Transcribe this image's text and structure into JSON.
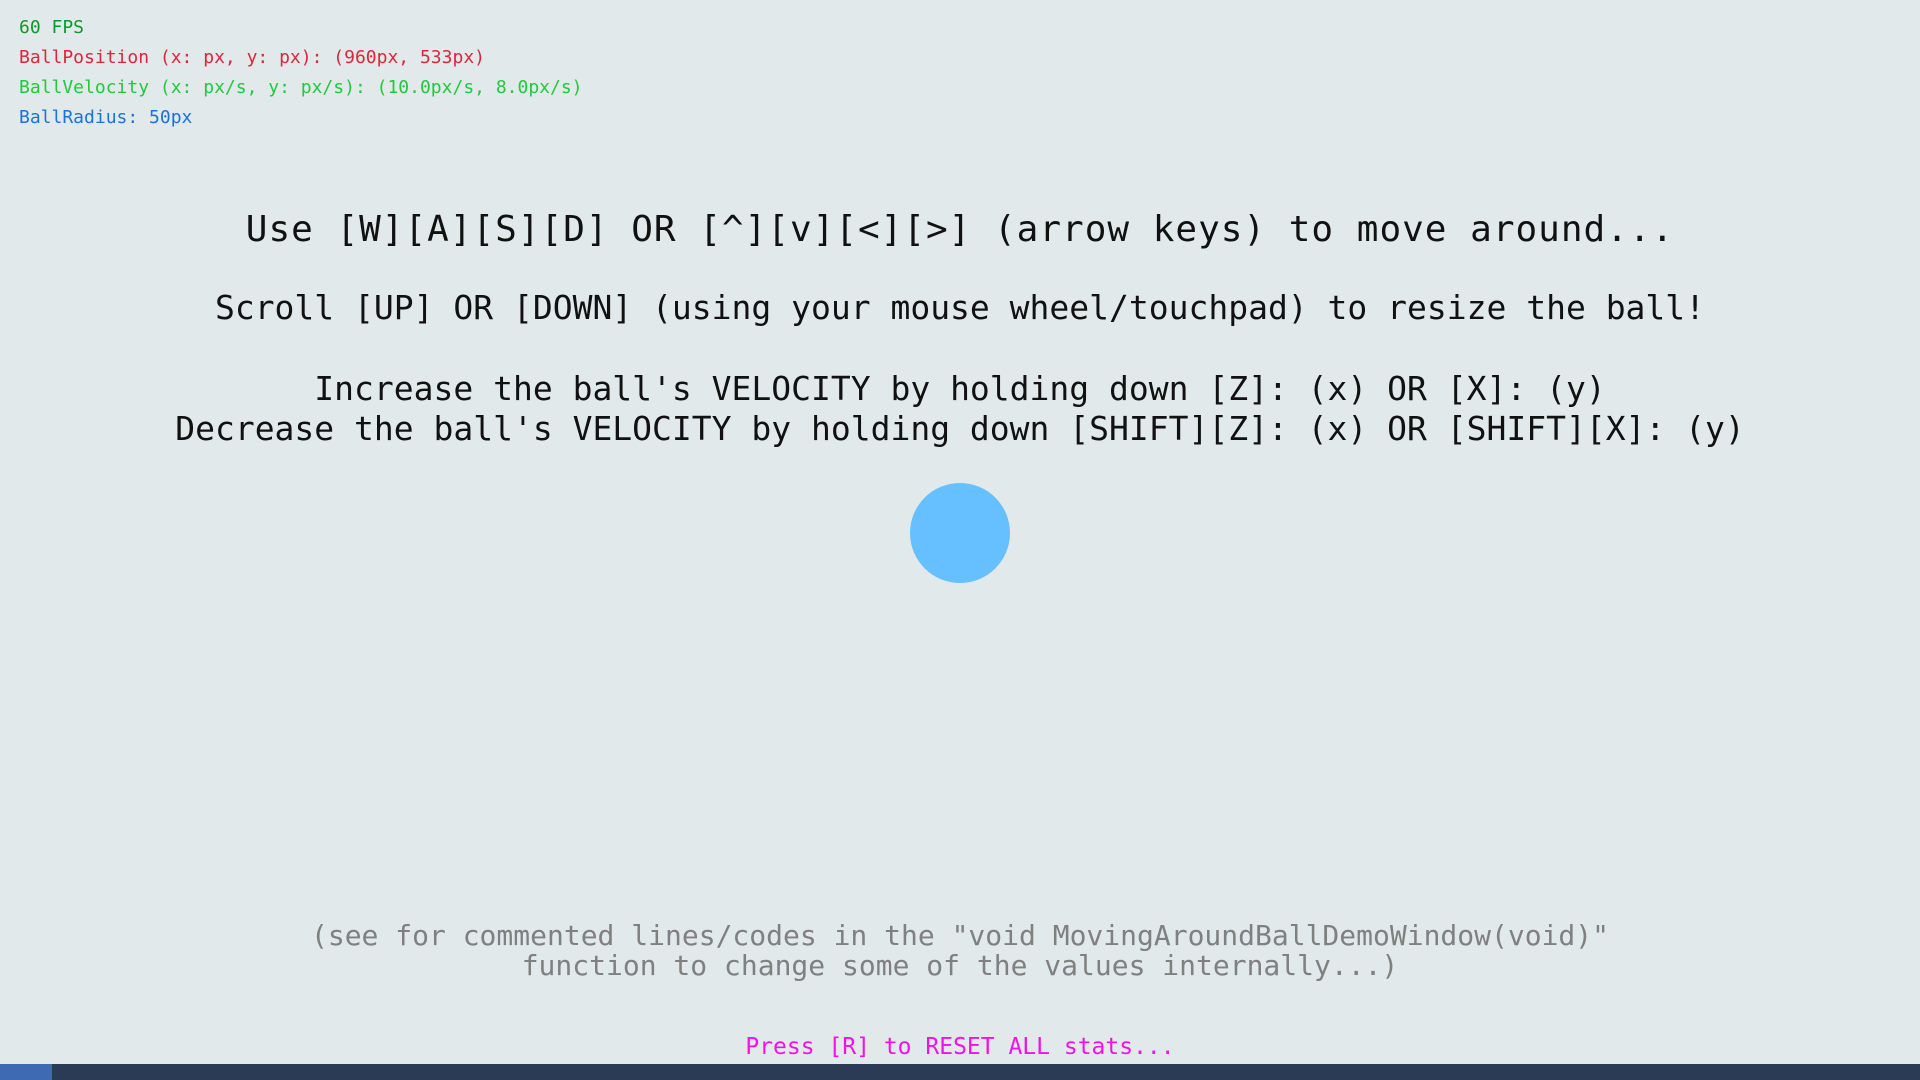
{
  "stats": {
    "fps": "60 FPS",
    "ball_position": "BallPosition (x: px, y: px): (960px, 533px)",
    "ball_velocity": "BallVelocity (x: px/s, y: px/s): (10.0px/s, 8.0px/s)",
    "ball_radius": "BallRadius: 50px"
  },
  "instructions": {
    "move": "Use [W][A][S][D] OR [^][v][<][>] (arrow keys) to move around...",
    "scroll": "Scroll [UP] OR [DOWN] (using your mouse wheel/touchpad) to resize the ball!",
    "increase": "Increase the ball's VELOCITY by holding down [Z]: (x) OR [X]: (y)",
    "decrease": "Decrease the ball's VELOCITY by holding down [SHIFT][Z]: (x) OR [SHIFT][X]: (y)"
  },
  "note": {
    "line1": "(see for commented lines/codes in the \"void MovingAroundBallDemoWindow(void)\"",
    "line2": "function to change some of the values internally...)"
  },
  "reset_hint": "Press [R] to RESET ALL stats...",
  "colors": {
    "background": "#e1e9eb",
    "fps": "#0b9a2a",
    "position": "#e0243a",
    "velocity": "#22c93d",
    "radius": "#1a73d8",
    "ball": "#66bfff",
    "note": "#808080",
    "reset": "#f012e6"
  }
}
